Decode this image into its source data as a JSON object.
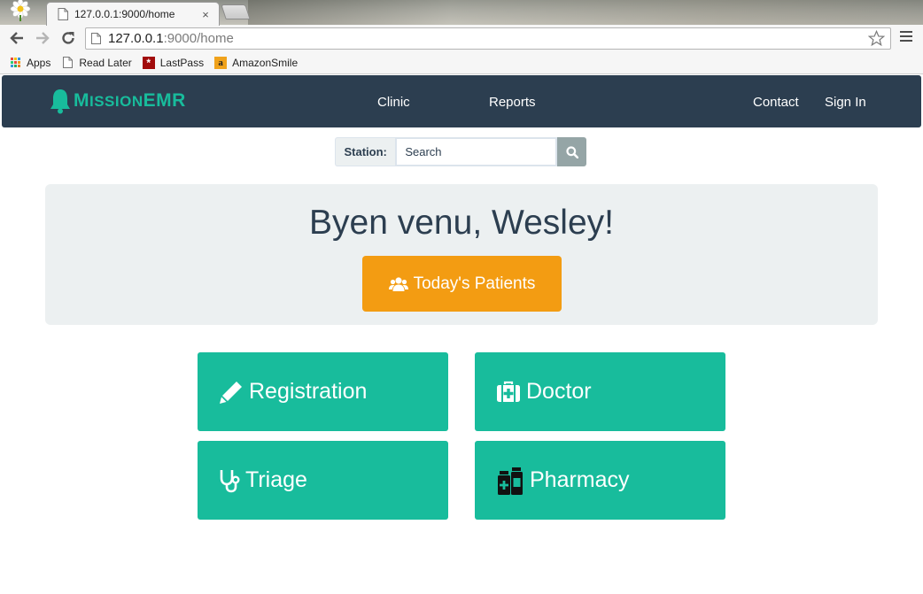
{
  "browser": {
    "tab_title": "127.0.0.1:9000/home",
    "tab_close": "×",
    "url_host": "127.0.0.1",
    "url_rest": ":9000/home",
    "bookmarks": [
      {
        "label": "Apps",
        "icon": "apps-grid-icon"
      },
      {
        "label": "Read Later",
        "icon": "page-icon"
      },
      {
        "label": "LastPass",
        "icon": "lastpass-icon"
      },
      {
        "label": "AmazonSmile",
        "icon": "amazon-icon"
      }
    ]
  },
  "navbar": {
    "brand_first": "M",
    "brand_rest": "ISSION",
    "brand_tail": "EMR",
    "links": [
      "Clinic",
      "Reports",
      "Contact",
      "Sign In"
    ]
  },
  "station": {
    "label": "Station:",
    "placeholder": "Search"
  },
  "welcome": {
    "heading": "Byen venu, Wesley!",
    "button_label": "Today's Patients"
  },
  "tiles": [
    {
      "label": "Registration",
      "icon": "pencil-icon"
    },
    {
      "label": "Doctor",
      "icon": "medkit-icon"
    },
    {
      "label": "Triage",
      "icon": "stethoscope-icon"
    },
    {
      "label": "Pharmacy",
      "icon": "medicine-bottles-icon"
    }
  ],
  "colors": {
    "navbar": "#2c3e50",
    "brand": "#18bc9c",
    "tile": "#18bc9c",
    "primary_button": "#f39c12",
    "jumbotron": "#ecf0f1"
  }
}
